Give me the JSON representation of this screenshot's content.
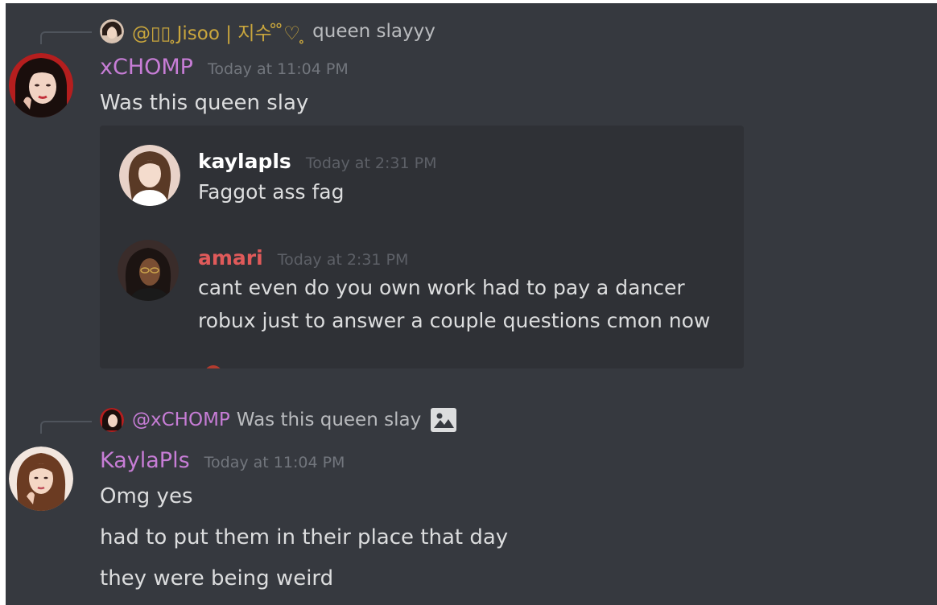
{
  "colors": {
    "background": "#36393f",
    "embed_background": "#2f3136",
    "timestamp": "#72767d",
    "message_text": "#dcddde",
    "username_pink": "#c77dd6",
    "username_red": "#e05a5a",
    "username_white": "#ffffff",
    "reply_gold": "#c9a63d"
  },
  "messages": [
    {
      "reply_to": {
        "author": "@▯▯ ̥Jisoo | 지수 ̊ ̊♡ ̥",
        "text": "queen slayyy",
        "author_color": "#c9a63d"
      },
      "author": "xCHOMP",
      "author_color": "#c77dd6",
      "timestamp": "Today at 11:04 PM",
      "lines": [
        "Was this queen slay"
      ],
      "embed": {
        "messages": [
          {
            "author": "kaylapls",
            "author_color": "#ffffff",
            "timestamp": "Today at 2:31 PM",
            "lines": [
              "Faggot ass fag"
            ]
          },
          {
            "author": "amari",
            "author_color": "#e05a5a",
            "timestamp": "Today at 2:31 PM",
            "lines": [
              "cant even do you own work had to pay a dancer",
              "robux just to answer a couple questions cmon now"
            ]
          }
        ]
      }
    },
    {
      "reply_to": {
        "author": "@xCHOMP",
        "text": "Was this queen slay",
        "author_color": "#c77dd6",
        "attachment_icon": "image-icon"
      },
      "author": "KaylaPls",
      "author_color": "#c77dd6",
      "timestamp": "Today at 11:04 PM",
      "lines": [
        "Omg yes",
        "had to put them in their place that day",
        "they were being weird"
      ]
    }
  ]
}
